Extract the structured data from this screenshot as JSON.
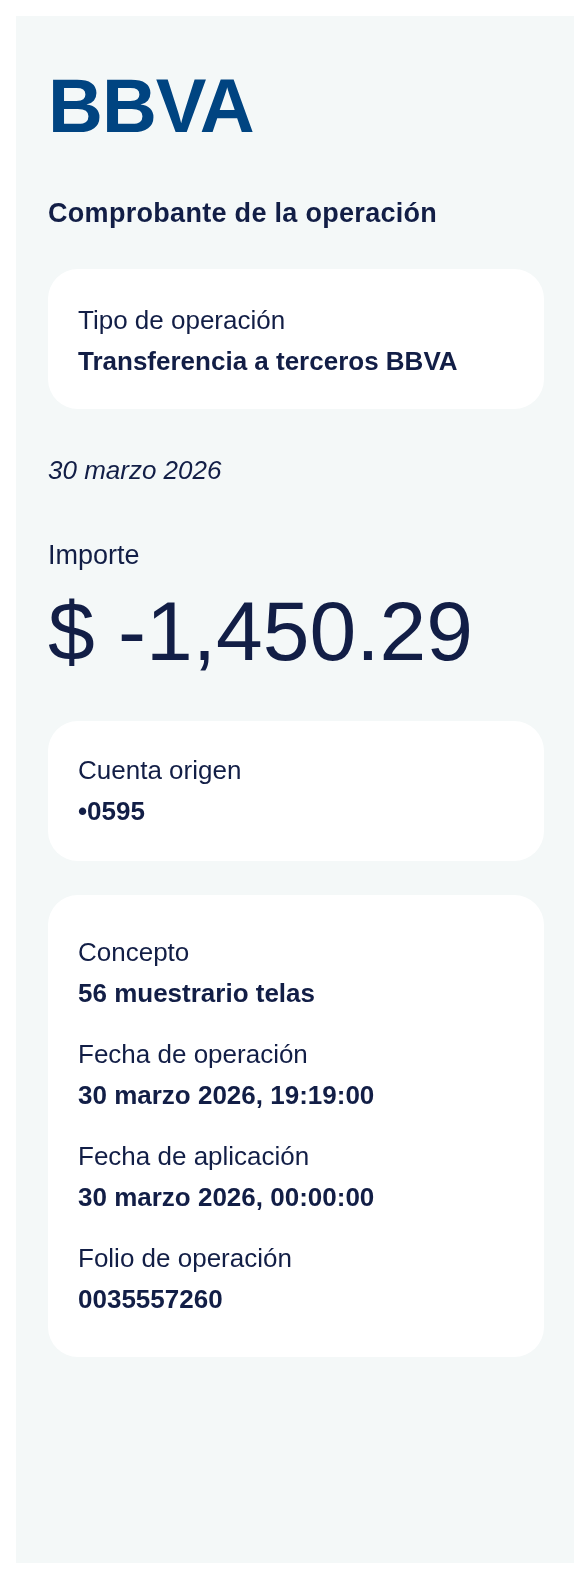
{
  "logo": "BBVA",
  "title": "Comprobante de la operación",
  "operation": {
    "fields": [
      {
        "label": "Tipo de operación",
        "value": "Transferencia a terceros BBVA"
      }
    ]
  },
  "date": "30 marzo 2026",
  "amount": {
    "label": "Importe",
    "value": "$ -1,450.29"
  },
  "account": {
    "fields": [
      {
        "label": "Cuenta origen",
        "value": "•0595"
      }
    ]
  },
  "details": {
    "fields": [
      {
        "label": "Concepto",
        "value": "56 muestrario telas"
      },
      {
        "label": "Fecha de operación",
        "value": "30 marzo 2026, 19:19:00"
      },
      {
        "label": "Fecha de aplicación",
        "value": "30 marzo 2026, 00:00:00"
      },
      {
        "label": "Folio de operación",
        "value": "0035557260"
      }
    ]
  }
}
